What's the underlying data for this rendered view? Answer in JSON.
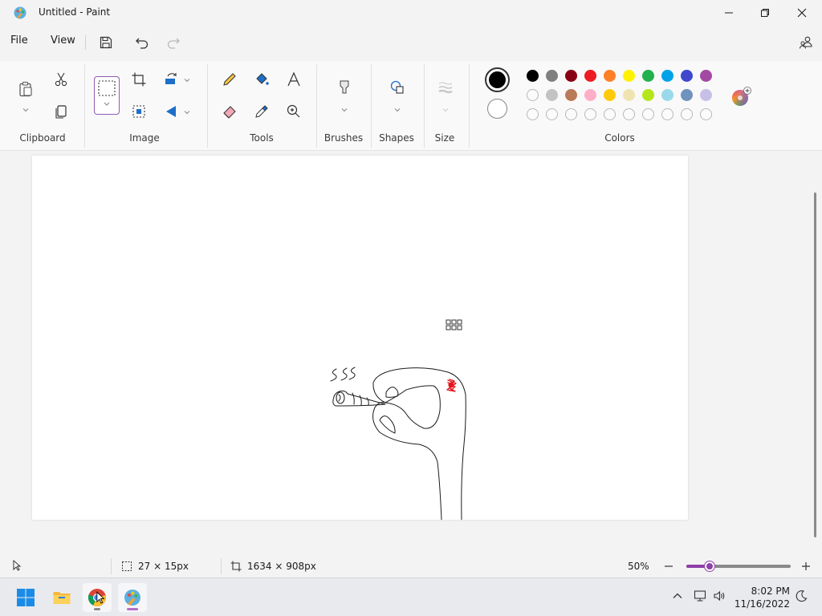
{
  "window": {
    "title": "Untitled - Paint"
  },
  "menu": {
    "file": "File",
    "view": "View"
  },
  "ribbon": {
    "groups": {
      "clipboard": "Clipboard",
      "image": "Image",
      "tools": "Tools",
      "brushes": "Brushes",
      "shapes": "Shapes",
      "size": "Size",
      "colors": "Colors"
    },
    "active_color1": "#000000",
    "active_color2": "#ffffff",
    "palette_row1": [
      "#000000",
      "#7f7f7f",
      "#880015",
      "#ed1c24",
      "#ff7f27",
      "#fff200",
      "#22b14c",
      "#00a2e8",
      "#3f48cc",
      "#a349a4"
    ],
    "palette_row2": [
      "#ffffff",
      "#c3c3c3",
      "#b97a57",
      "#ffaec9",
      "#ffc90e",
      "#efe4b0",
      "#b5e61d",
      "#99d9ea",
      "#7092be",
      "#c8bfe7"
    ],
    "palette_row3_empty_count": 10
  },
  "status": {
    "selection_size": "27 × 15px",
    "canvas_size": "1634 × 908px",
    "zoom": "50%",
    "zoom_level_fraction": 0.22
  },
  "taskbar": {
    "time": "8:02 PM",
    "date": "11/16/2022"
  },
  "colors": {
    "accent": "#8e3fa8",
    "canvas_bg": "#ffffff",
    "stroke": "#1b1b1b",
    "scribble": "#e3161d"
  }
}
